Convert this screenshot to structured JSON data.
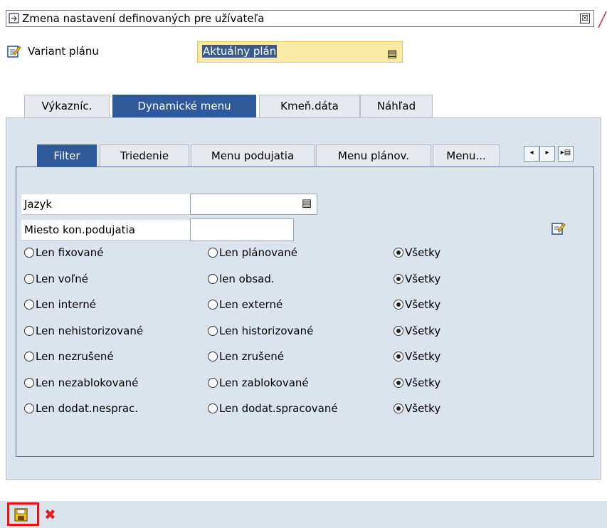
{
  "window": {
    "title": "Zmena nastavení definovaných pre užívateľa",
    "close_glyph": "☒"
  },
  "header": {
    "variant_label": "Variant plánu",
    "variant_value": "Aktuálny plán",
    "f4_glyph": "▤"
  },
  "outer_tabs": [
    {
      "label": "Výkazníc.",
      "active": false
    },
    {
      "label": "Dynamické menu",
      "active": true
    },
    {
      "label": "Kmeň.dáta",
      "active": false
    },
    {
      "label": "Náhľad",
      "active": false
    }
  ],
  "inner_tabs": [
    {
      "label": "Filter",
      "active": true
    },
    {
      "label": "Triedenie",
      "active": false
    },
    {
      "label": "Menu podujatia",
      "active": false
    },
    {
      "label": "Menu plánov.",
      "active": false
    },
    {
      "label": "Menu...",
      "active": false
    }
  ],
  "tab_nav": {
    "left": "◂",
    "right": "▸",
    "list": "▸▤"
  },
  "filter": {
    "language_label": "Jazyk",
    "language_value": "",
    "location_label": "Miesto kon.podujatia",
    "location_value": "",
    "radio_rows": [
      {
        "a": "Len fixované",
        "b": "Len plánované",
        "c": "Všetky",
        "selected": "c"
      },
      {
        "a": "Len voľné",
        "b": "len obsad.",
        "c": "Všetky",
        "selected": "c"
      },
      {
        "a": "Len interné",
        "b": "Len externé",
        "c": "Všetky",
        "selected": "c"
      },
      {
        "a": "Len nehistorizované",
        "b": "Len historizované",
        "c": "Všetky",
        "selected": "c"
      },
      {
        "a": "Len nezrušené",
        "b": "Len zrušené",
        "c": "Všetky",
        "selected": "c"
      },
      {
        "a": "Len nezablokované",
        "b": "Len zablokované",
        "c": "Všetky",
        "selected": "c"
      },
      {
        "a": "Len dodat.nesprac.",
        "b": "Len dodat.spracované",
        "c": "Všetky",
        "selected": "c"
      }
    ]
  },
  "footer": {
    "save_icon": "save-icon",
    "cancel_glyph": "✖"
  },
  "colors": {
    "tab_active": "#2f5a9a",
    "panel": "#dbe3ec",
    "input_highlight": "#fbe9a6",
    "cancel": "#e11d1d",
    "save_outline": "#ee1111"
  }
}
